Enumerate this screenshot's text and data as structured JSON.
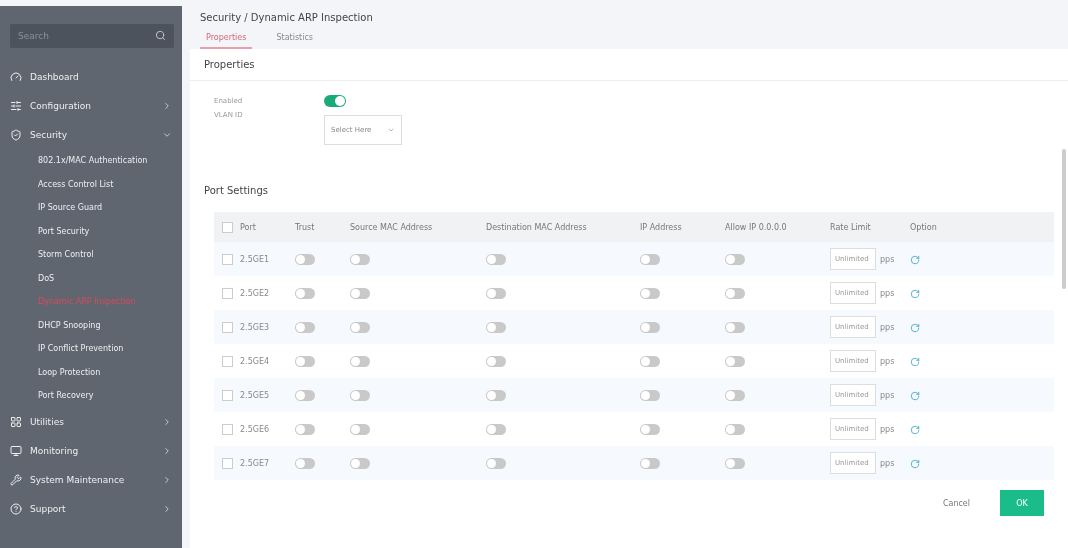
{
  "sidebar": {
    "search": {
      "placeholder": "Search"
    },
    "items": [
      {
        "label": "Dashboard"
      },
      {
        "label": "Configuration"
      },
      {
        "label": "Security",
        "children": [
          {
            "label": "802.1x/MAC Authentication",
            "selected": false
          },
          {
            "label": "Access Control List",
            "selected": false
          },
          {
            "label": "IP Source Guard",
            "selected": false
          },
          {
            "label": "Port Security",
            "selected": false
          },
          {
            "label": "Storm Control",
            "selected": false
          },
          {
            "label": "DoS",
            "selected": false
          },
          {
            "label": "Dynamic ARP Inspection",
            "selected": true
          },
          {
            "label": "DHCP Snooping",
            "selected": false
          },
          {
            "label": "IP Conflict Prevention",
            "selected": false
          },
          {
            "label": "Loop Protection",
            "selected": false
          },
          {
            "label": "Port Recovery",
            "selected": false
          }
        ]
      },
      {
        "label": "Utilities"
      },
      {
        "label": "Monitoring"
      },
      {
        "label": "System Maintenance"
      },
      {
        "label": "Support"
      }
    ]
  },
  "breadcrumb": "Security /  Dynamic ARP Inspection",
  "tabs": [
    {
      "label": "Properties",
      "selected": true
    },
    {
      "label": "Statistics",
      "selected": false
    }
  ],
  "properties": {
    "title": "Properties",
    "enabled": {
      "label": "Enabled",
      "on": true
    },
    "vlan": {
      "label": "VLAN ID",
      "placeholder": "Select Here"
    }
  },
  "port_settings": {
    "title": "Port Settings",
    "select_all_checked": false,
    "columns": [
      "Port",
      "Trust",
      "Source MAC Address",
      "Destination MAC Address",
      "IP Address",
      "Allow IP 0.0.0.0",
      "Rate Limit",
      "Option"
    ],
    "rows": [
      {
        "port": "2.5GE1",
        "checked": false,
        "trust": false,
        "src_mac": false,
        "dst_mac": false,
        "ip": false,
        "allow_ip": false,
        "rate": "Unlimited",
        "unit": "pps"
      },
      {
        "port": "2.5GE2",
        "checked": false,
        "trust": false,
        "src_mac": false,
        "dst_mac": false,
        "ip": false,
        "allow_ip": false,
        "rate": "Unlimited",
        "unit": "pps"
      },
      {
        "port": "2.5GE3",
        "checked": false,
        "trust": false,
        "src_mac": false,
        "dst_mac": false,
        "ip": false,
        "allow_ip": false,
        "rate": "Unlimited",
        "unit": "pps"
      },
      {
        "port": "2.5GE4",
        "checked": false,
        "trust": false,
        "src_mac": false,
        "dst_mac": false,
        "ip": false,
        "allow_ip": false,
        "rate": "Unlimited",
        "unit": "pps"
      },
      {
        "port": "2.5GE5",
        "checked": false,
        "trust": false,
        "src_mac": false,
        "dst_mac": false,
        "ip": false,
        "allow_ip": false,
        "rate": "Unlimited",
        "unit": "pps"
      },
      {
        "port": "2.5GE6",
        "checked": false,
        "trust": false,
        "src_mac": false,
        "dst_mac": false,
        "ip": false,
        "allow_ip": false,
        "rate": "Unlimited",
        "unit": "pps"
      },
      {
        "port": "2.5GE7",
        "checked": false,
        "trust": false,
        "src_mac": false,
        "dst_mac": false,
        "ip": false,
        "allow_ip": false,
        "rate": "Unlimited",
        "unit": "pps"
      }
    ]
  },
  "buttons": {
    "cancel": "Cancel",
    "ok": "OK"
  }
}
